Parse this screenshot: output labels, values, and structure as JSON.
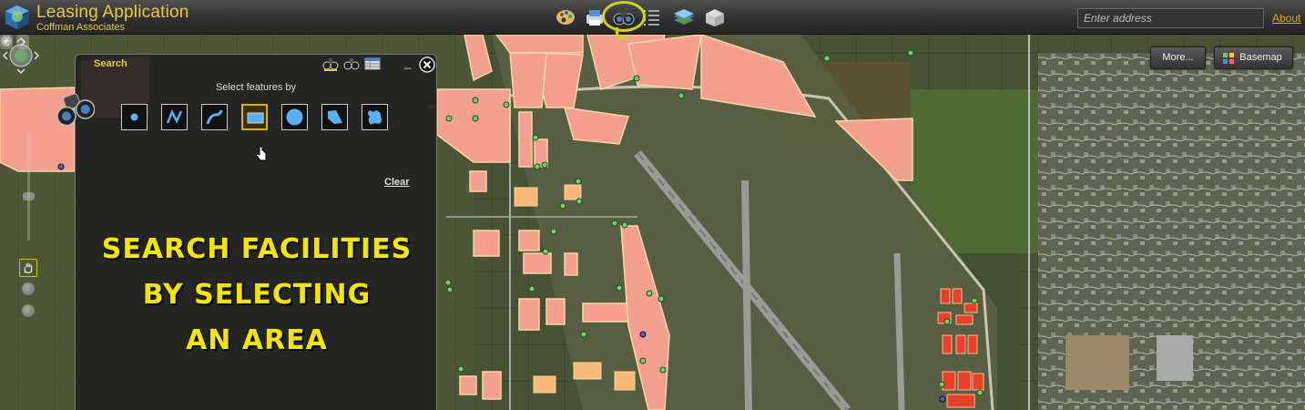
{
  "app": {
    "title": "Leasing Application",
    "subtitle": "Coffman Associates",
    "logo_icon": "globe-cube-icon"
  },
  "toolbar": {
    "tools": [
      {
        "name": "layers-palette-icon"
      },
      {
        "name": "print-map-icon"
      },
      {
        "name": "search-binoculars-icon",
        "active": true
      },
      {
        "name": "legend-list-icon"
      },
      {
        "name": "basemap-layers-icon"
      },
      {
        "name": "box-tool-icon"
      }
    ]
  },
  "header_right": {
    "address_placeholder": "Enter address",
    "about_label": "About"
  },
  "map": {
    "more_label": "More...",
    "basemap_label": "Basemap"
  },
  "search_panel": {
    "title": "Search",
    "instruction": "Select features by",
    "tools": [
      {
        "name": "point-icon"
      },
      {
        "name": "polyline-icon"
      },
      {
        "name": "freehand-line-icon"
      },
      {
        "name": "rectangle-icon",
        "selected": true
      },
      {
        "name": "circle-icon"
      },
      {
        "name": "polygon-icon"
      },
      {
        "name": "freehand-polygon-icon"
      }
    ],
    "clear_label": "Clear",
    "caption_lines": [
      "SEARCH FACILITIES",
      "BY SELECTING",
      "AN AREA"
    ]
  },
  "colors": {
    "accent": "#e6c84a",
    "parcel": "#f4a090",
    "parcel_selected": "#e8402a",
    "caption": "#f2e600",
    "highlight": "#cfd12a"
  }
}
